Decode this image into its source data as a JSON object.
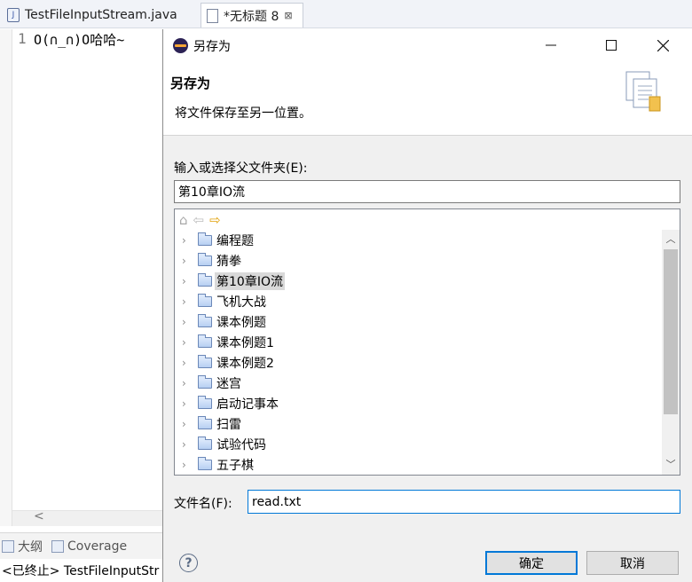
{
  "editor": {
    "tabs": [
      {
        "label": "TestFileInputStream.java"
      },
      {
        "label": "*无标题 8",
        "close_glyph": "⊠"
      }
    ],
    "line_number": "1",
    "code_text": "O(∩_∩)O哈哈~",
    "bottom_views": [
      "大纲",
      "Coverage"
    ],
    "console_text": "<已终止> TestFileInputStr"
  },
  "dialog": {
    "title": "另存为",
    "header_title": "另存为",
    "header_desc": "将文件保存至另一位置。",
    "folder_label": "输入或选择父文件夹(E):",
    "folder_value": "第10章IO流",
    "tree_items": [
      {
        "label": "编程题",
        "selected": false
      },
      {
        "label": "猜拳",
        "selected": false
      },
      {
        "label": "第10章IO流",
        "selected": true
      },
      {
        "label": "飞机大战",
        "selected": false
      },
      {
        "label": "课本例题",
        "selected": false
      },
      {
        "label": "课本例题1",
        "selected": false
      },
      {
        "label": "课本例题2",
        "selected": false
      },
      {
        "label": "迷宫",
        "selected": false
      },
      {
        "label": "启动记事本",
        "selected": false
      },
      {
        "label": "扫雷",
        "selected": false
      },
      {
        "label": "试验代码",
        "selected": false
      },
      {
        "label": "五子棋",
        "selected": false
      }
    ],
    "filename_label": "文件名(F):",
    "filename_value": "read.txt",
    "ok_label": "确定",
    "cancel_label": "取消"
  },
  "icons": [
    "eclipse-logo-icon",
    "minimize-icon",
    "maximize-icon",
    "close-icon",
    "home-icon",
    "back-arrow-icon",
    "forward-arrow-icon",
    "folder-icon",
    "chevron-right-icon",
    "help-icon"
  ],
  "colors": {
    "accent": "#0078d7",
    "tree_selection": "#d9d9d9",
    "forward_arrow": "#e1a10a"
  }
}
